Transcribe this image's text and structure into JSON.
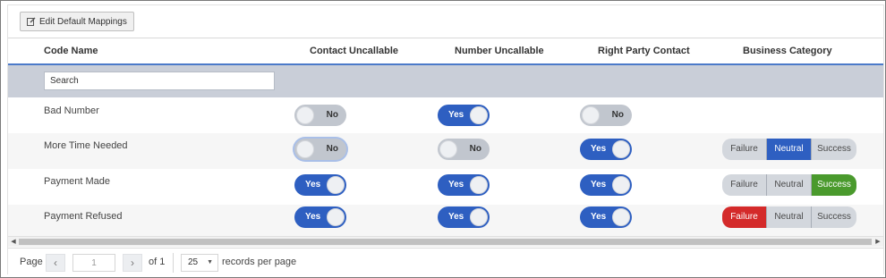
{
  "toolbar": {
    "edit_label": "Edit Default Mappings",
    "edit_icon": "edit-icon"
  },
  "table": {
    "headers": {
      "code_name": "Code Name",
      "contact_uncallable": "Contact Uncallable",
      "number_uncallable": "Number Uncallable",
      "right_party_contact": "Right Party Contact",
      "business_category": "Business Category"
    },
    "search_placeholder": "Search",
    "rows": [
      {
        "name": "Bad Number",
        "contact_uncallable": "No",
        "number_uncallable": "Yes",
        "right_party_contact": "No",
        "business_category": null
      },
      {
        "name": "More Time Needed",
        "contact_uncallable": "No",
        "number_uncallable": "No",
        "right_party_contact": "Yes",
        "business_category": "Neutral"
      },
      {
        "name": "Payment Made",
        "contact_uncallable": "Yes",
        "number_uncallable": "Yes",
        "right_party_contact": "Yes",
        "business_category": "Success"
      },
      {
        "name": "Payment Refused",
        "contact_uncallable": "Yes",
        "number_uncallable": "Yes",
        "right_party_contact": "Yes",
        "business_category": "Failure"
      }
    ],
    "category_options": {
      "failure": "Failure",
      "neutral": "Neutral",
      "success": "Success"
    }
  },
  "colors": {
    "toggle_on": "#2e5fc1",
    "toggle_off": "#c1c6ce",
    "neutral_active": "#2e5fc1",
    "success_active": "#4a9a2d",
    "failure_active": "#d42a2a",
    "header_underline": "#4b7ac9"
  },
  "pagination": {
    "page_label": "Page",
    "current_page": "1",
    "of_label": "of 1",
    "per_page": "25",
    "per_page_label": "records per page",
    "prev_icon": "chevron-left-icon",
    "next_icon": "chevron-right-icon"
  }
}
